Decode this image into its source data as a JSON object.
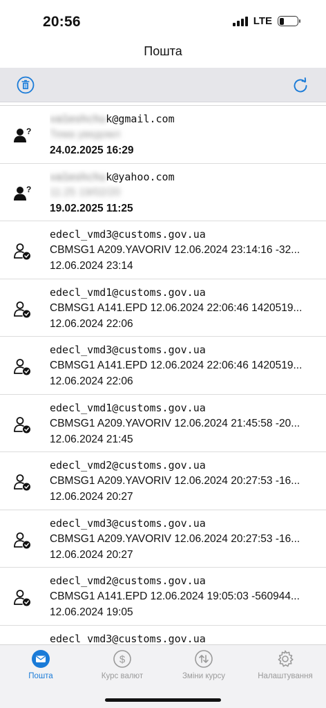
{
  "status_bar": {
    "time": "20:56",
    "network": "LTE"
  },
  "header": {
    "title": "Пошта"
  },
  "toolbar": {
    "delete_icon": "trash-icon",
    "refresh_icon": "refresh-icon",
    "accent": "#1a7bd8"
  },
  "mails": [
    {
      "from_hidden": "va1eshchu",
      "from_visible": "k@gmail.com",
      "subject": "Тема уведомл",
      "date": "24.02.2025 16:29",
      "unread": true,
      "subject_hidden": true,
      "icon": "unknown-user-icon"
    },
    {
      "from_hidden": "va1eshchu",
      "from_visible": "k@yahoo.com",
      "subject": "11:25 19/02/20",
      "date": "19.02.2025 11:25",
      "unread": true,
      "subject_hidden": true,
      "icon": "unknown-user-icon"
    },
    {
      "from_hidden": "",
      "from_visible": "edecl_vmd3@customs.gov.ua",
      "subject": "CBMSG1 A209.YAVORIV 12.06.2024 23:14:16 -32...",
      "date": "12.06.2024 23:14",
      "unread": false,
      "subject_hidden": false,
      "icon": "verified-user-icon"
    },
    {
      "from_hidden": "",
      "from_visible": "edecl_vmd1@customs.gov.ua",
      "subject": "CBMSG1 A141.EPD 12.06.2024 22:06:46 1420519...",
      "date": "12.06.2024 22:06",
      "unread": false,
      "subject_hidden": false,
      "icon": "verified-user-icon"
    },
    {
      "from_hidden": "",
      "from_visible": "edecl_vmd3@customs.gov.ua",
      "subject": "CBMSG1 A141.EPD 12.06.2024 22:06:46 1420519...",
      "date": "12.06.2024 22:06",
      "unread": false,
      "subject_hidden": false,
      "icon": "verified-user-icon"
    },
    {
      "from_hidden": "",
      "from_visible": "edecl_vmd1@customs.gov.ua",
      "subject": "CBMSG1 A209.YAVORIV 12.06.2024 21:45:58 -20...",
      "date": "12.06.2024 21:45",
      "unread": false,
      "subject_hidden": false,
      "icon": "verified-user-icon"
    },
    {
      "from_hidden": "",
      "from_visible": "edecl_vmd2@customs.gov.ua",
      "subject": "CBMSG1 A209.YAVORIV 12.06.2024 20:27:53 -16...",
      "date": "12.06.2024 20:27",
      "unread": false,
      "subject_hidden": false,
      "icon": "verified-user-icon"
    },
    {
      "from_hidden": "",
      "from_visible": "edecl_vmd3@customs.gov.ua",
      "subject": "CBMSG1 A209.YAVORIV 12.06.2024 20:27:53 -16...",
      "date": "12.06.2024 20:27",
      "unread": false,
      "subject_hidden": false,
      "icon": "verified-user-icon"
    },
    {
      "from_hidden": "",
      "from_visible": "edecl_vmd2@customs.gov.ua",
      "subject": "CBMSG1 A141.EPD 12.06.2024 19:05:03 -560944...",
      "date": "12.06.2024 19:05",
      "unread": false,
      "subject_hidden": false,
      "icon": "verified-user-icon"
    },
    {
      "from_hidden": "",
      "from_visible": "edecl_vmd3@customs.gov.ua",
      "subject": "",
      "date": "",
      "unread": false,
      "subject_hidden": false,
      "icon": "verified-user-icon"
    }
  ],
  "tabs": [
    {
      "label": "Пошта",
      "icon": "mail-icon",
      "active": true
    },
    {
      "label": "Курс валют",
      "icon": "dollar-icon",
      "active": false
    },
    {
      "label": "Зміни курсу",
      "icon": "exchange-icon",
      "active": false
    },
    {
      "label": "Налаштування",
      "icon": "gear-icon",
      "active": false
    }
  ]
}
